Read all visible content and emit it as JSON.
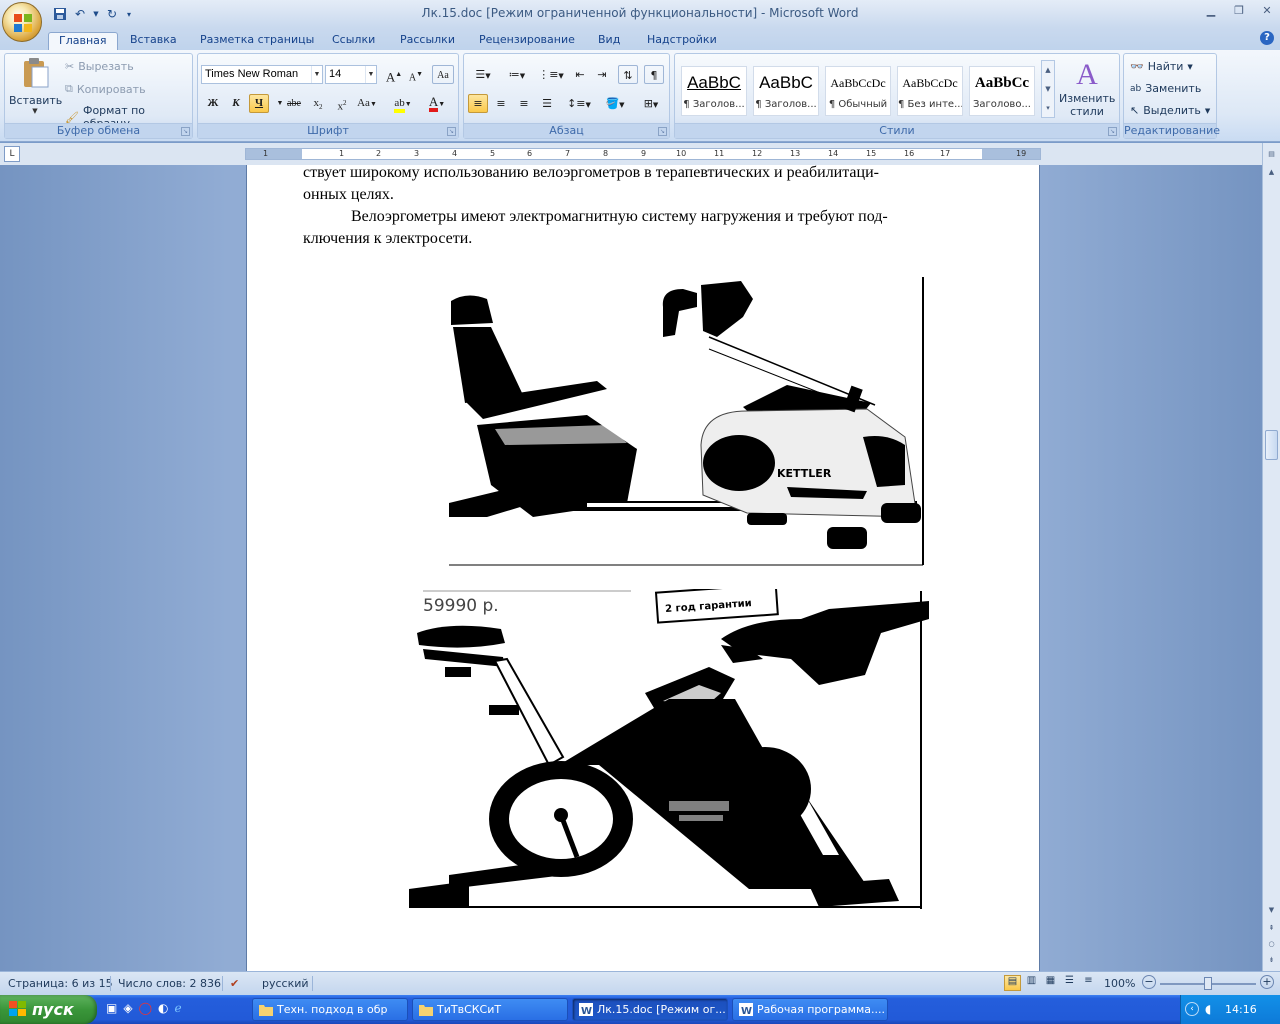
{
  "window": {
    "title": "Лк.15.doc [Режим ограниченной функциональности] - Microsoft Word"
  },
  "tabs": [
    "Главная",
    "Вставка",
    "Разметка страницы",
    "Ссылки",
    "Рассылки",
    "Рецензирование",
    "Вид",
    "Надстройки"
  ],
  "clipboard": {
    "paste": "Вставить",
    "cut": "Вырезать",
    "copy": "Копировать",
    "format_painter": "Формат по образцу",
    "label": "Буфер обмена"
  },
  "font": {
    "name": "Times New Roman",
    "size": "14",
    "label": "Шрифт",
    "bold": "Ж",
    "italic": "К",
    "underline": "Ч",
    "strike": "abe",
    "change_case": "Aa"
  },
  "paragraph": {
    "label": "Абзац"
  },
  "styles": {
    "label": "Стили",
    "items": [
      {
        "preview": "AaBbC",
        "name": "¶ Заголов..."
      },
      {
        "preview": "AaBbC",
        "name": "¶ Заголов..."
      },
      {
        "preview": "AaBbCcDc",
        "name": "¶ Обычный"
      },
      {
        "preview": "AaBbCcDc",
        "name": "¶ Без инте..."
      },
      {
        "preview": "AaBbCc",
        "name": "Заголово..."
      }
    ],
    "change": "Изменить стили"
  },
  "editing": {
    "find": "Найти",
    "replace": "Заменить",
    "select": "Выделить",
    "label": "Редактирование"
  },
  "ruler": {
    "ticks": [
      "1",
      "2",
      "1",
      "2",
      "3",
      "4",
      "5",
      "6",
      "7",
      "8",
      "9",
      "10",
      "11",
      "12",
      "13",
      "14",
      "15",
      "16",
      "17",
      "19"
    ]
  },
  "document": {
    "line1": "ствует широкому использованию велоэргометров в терапевтических и реабилитаци-",
    "line2": "онных целях.",
    "line3": "Велоэргометры имеют электромагнитную систему нагружения и требуют под-",
    "line4": "ключения к электросети.",
    "image1_brand": "KETTLER",
    "image2_price": "59990 р.",
    "image2_sticker": "2 год гарантии"
  },
  "status": {
    "page": "Страница: 6 из 15",
    "words": "Число слов: 2 836",
    "language": "русский",
    "zoom": "100%"
  },
  "taskbar": {
    "start": "пуск",
    "tasks": [
      "Техн. подход в обр",
      "ТиТвСКСиТ",
      "Лк.15.doc [Режим ог...",
      "Рабочая программа...."
    ],
    "lang": "RU",
    "time": "14:16"
  }
}
